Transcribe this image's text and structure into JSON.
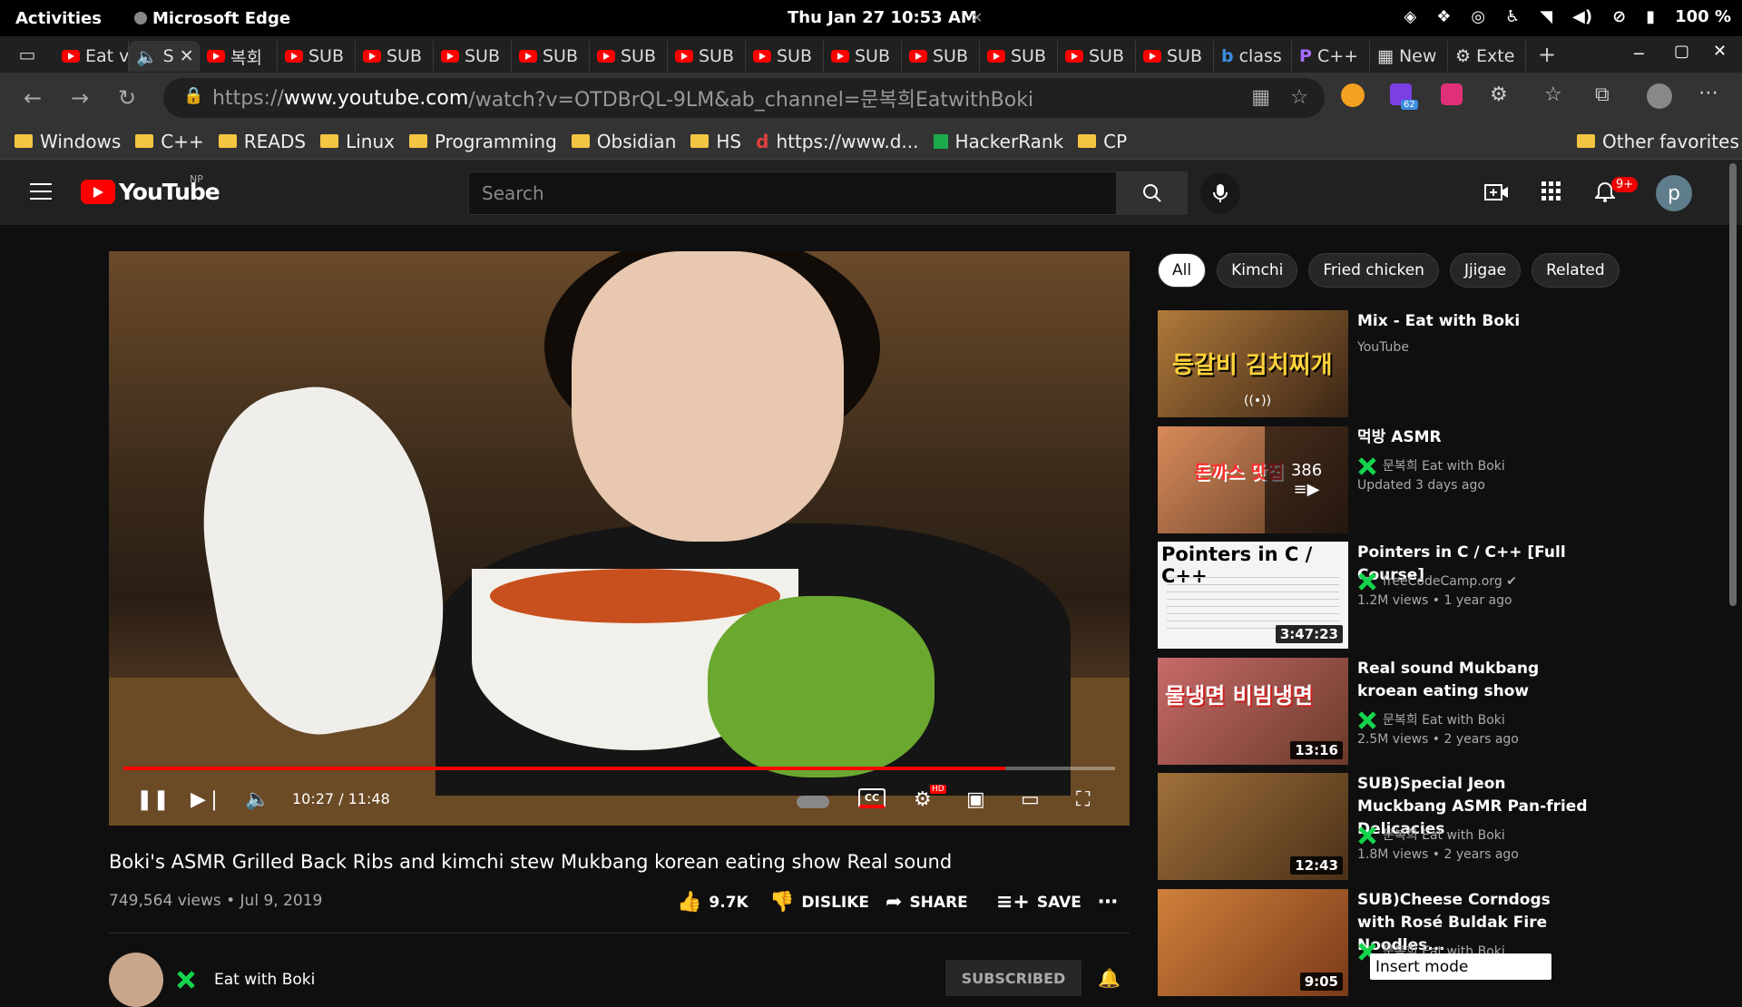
{
  "system_bar": {
    "activities": "Activities",
    "app_name": "Microsoft Edge",
    "clock": "Thu Jan 27  10:53 AM",
    "battery": "100 %"
  },
  "tabs": [
    {
      "label": "Eat v"
    },
    {
      "label": "S"
    },
    {
      "label": "복회"
    },
    {
      "label": "SUB"
    },
    {
      "label": "SUB"
    },
    {
      "label": "SUB"
    },
    {
      "label": "SUB"
    },
    {
      "label": "SUB"
    },
    {
      "label": "SUB"
    },
    {
      "label": "SUB"
    },
    {
      "label": "SUB"
    },
    {
      "label": "SUB"
    },
    {
      "label": "SUB"
    },
    {
      "label": "SUB"
    },
    {
      "label": "SUB"
    },
    {
      "label": "class"
    },
    {
      "label": "C++"
    },
    {
      "label": "New"
    },
    {
      "label": "Exte"
    }
  ],
  "address": {
    "prefix": "https://",
    "domain": "www.youtube.com",
    "path": "/watch?v=OTDBrQL-9LM&ab_channel=문복희EatwithBoki",
    "extension_badge": "62"
  },
  "bookmarks": [
    {
      "label": "Windows",
      "type": "folder"
    },
    {
      "label": "C++",
      "type": "folder"
    },
    {
      "label": "READS",
      "type": "folder"
    },
    {
      "label": "Linux",
      "type": "folder"
    },
    {
      "label": "Programming",
      "type": "folder"
    },
    {
      "label": "Obsidian",
      "type": "folder"
    },
    {
      "label": "HS",
      "type": "folder"
    },
    {
      "label": "https://www.d...",
      "type": "link"
    },
    {
      "label": "HackerRank",
      "type": "link"
    },
    {
      "label": "CP",
      "type": "folder"
    }
  ],
  "other_favorites": "Other favorites",
  "youtube": {
    "logo_text": "YouTube",
    "region": "NP",
    "search_placeholder": "Search",
    "notifications_badge": "9+",
    "avatar_letter": "p"
  },
  "player": {
    "time": "10:27 / 11:48",
    "progress": 0.889,
    "hd_badge": "HD"
  },
  "video": {
    "title": "Boki's ASMR Grilled Back Ribs and kimchi stew Mukbang korean eating show Real sound",
    "views_date": "749,564 views • Jul 9, 2019",
    "likes": "9.7K",
    "dislike": "DISLIKE",
    "share": "SHARE",
    "save": "SAVE",
    "channel": "Eat with Boki",
    "subscribed": "SUBSCRIBED"
  },
  "chips": [
    "All",
    "Kimchi",
    "Fried chicken",
    "Jjigae",
    "Related"
  ],
  "recommendations": [
    {
      "title": "Mix - Eat with Boki",
      "channel": "YouTube",
      "stats": "",
      "duration": "",
      "verified": false,
      "thumb_text": "등갈비 김치찌개",
      "thumb_colors": [
        "#b07a3a",
        "#3a2416"
      ]
    },
    {
      "title": "먹방 ASMR",
      "channel": "문복희 Eat with Boki",
      "stats": "Updated 3 days ago",
      "duration": "",
      "verified": true,
      "playlist_count": "386",
      "thumb_text": "돈까스 맛집",
      "thumb_colors": [
        "#d98a5a",
        "#5a3a24"
      ]
    },
    {
      "title": "Pointers in C / C++ [Full Course]",
      "channel": "freeCodeCamp.org",
      "stats": "1.2M views • 1 year ago",
      "duration": "3:47:23",
      "verified": true,
      "thumb_text": "Pointers in C / C++",
      "thumb_colors": [
        "#ffffff",
        "#dcdcdc"
      ]
    },
    {
      "title": "Real sound Mukbang kroean eating show",
      "channel": "문복희 Eat with Boki",
      "stats": "2.5M views • 2 years ago",
      "duration": "13:16",
      "verified": true,
      "thumb_text": "물냉면 비빔냉면",
      "thumb_colors": [
        "#c86a6a",
        "#6a3a2a"
      ]
    },
    {
      "title": "SUB)Special Jeon Muckbang ASMR Pan-fried Delicacies",
      "channel": "문복희 Eat with Boki",
      "stats": "1.8M views • 2 years ago",
      "duration": "12:43",
      "verified": true,
      "thumb_text": "",
      "thumb_colors": [
        "#a0703a",
        "#4a3018"
      ]
    },
    {
      "title": "SUB)Cheese Corndogs with Rosé Buldak Fire Noodles...",
      "channel": "문복희 Eat with Boki",
      "stats": "",
      "duration": "9:05",
      "verified": true,
      "thumb_text": "",
      "thumb_colors": [
        "#d0803a",
        "#7a3a1a"
      ]
    }
  ],
  "insert_mode": "Insert mode"
}
